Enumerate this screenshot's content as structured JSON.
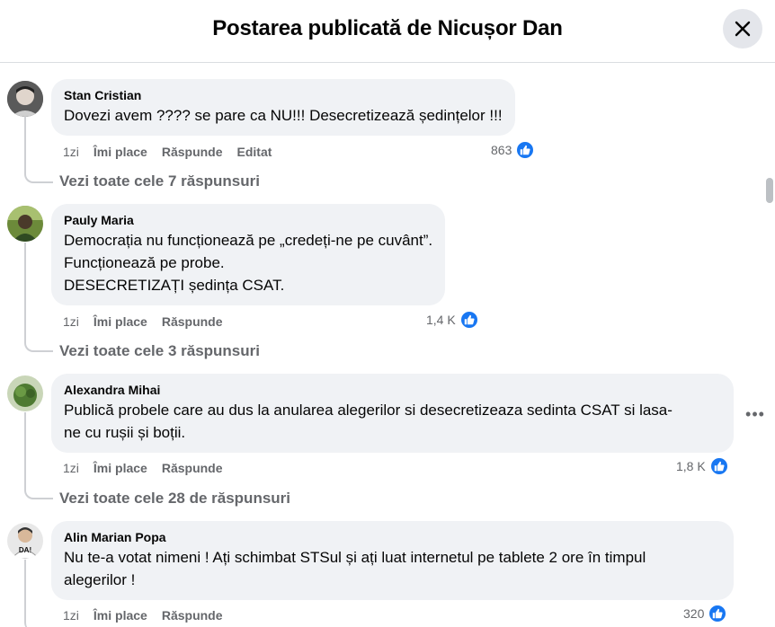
{
  "header": {
    "title": "Postarea publicată de Nicușor Dan"
  },
  "comments": [
    {
      "author": "Stan Cristian",
      "lines": [
        "Dovezi avem ???? se pare ca NU!!! Desecretizează ședințelor !!!"
      ],
      "time": "1zi",
      "like": "Îmi place",
      "reply": "Răspunde",
      "edited": "Editat",
      "reactions": "863",
      "replies": "Vezi toate cele 7 răspunsuri"
    },
    {
      "author": "Pauly Maria",
      "lines": [
        "Democrația nu funcționează pe „credeți-ne pe cuvânt”.",
        "Funcționează pe probe.",
        "DESECRETIZAȚI ședința CSAT."
      ],
      "time": "1zi",
      "like": "Îmi place",
      "reply": "Răspunde",
      "reactions": "1,4 K",
      "replies": "Vezi toate cele 3 răspunsuri"
    },
    {
      "author": "Alexandra Mihai",
      "lines": [
        "Publică probele care au dus la anularea alegerilor si desecretizeaza sedinta CSAT si lasa-",
        "ne cu rușii și boții."
      ],
      "time": "1zi",
      "like": "Îmi place",
      "reply": "Răspunde",
      "reactions": "1,8 K",
      "replies": "Vezi toate cele 28 de răspunsuri"
    },
    {
      "author": "Alin Marian Popa",
      "lines": [
        "Nu te-a votat nimeni ! Ați schimbat STSul și ați luat internetul pe tablete 2 ore în timpul",
        "alegerilor !"
      ],
      "time": "1zi",
      "like": "Îmi place",
      "reply": "Răspunde",
      "reactions": "320"
    }
  ],
  "icons": {
    "close": "close-icon",
    "like": "thumbs-up-icon",
    "more": "more-options-icon"
  },
  "colors": {
    "accent": "#1877f2",
    "bubble": "#f0f2f5",
    "secondary_text": "#65676b"
  }
}
